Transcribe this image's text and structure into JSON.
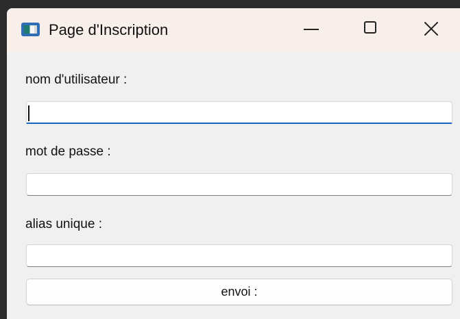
{
  "window": {
    "title": "Page d'Inscription",
    "app_icon": "app-window-icon",
    "controls": [
      {
        "name": "minimize",
        "icon": "minimize-icon"
      },
      {
        "name": "maximize",
        "icon": "maximize-icon"
      },
      {
        "name": "close",
        "icon": "close-icon"
      }
    ]
  },
  "form": {
    "username": {
      "label": "nom d'utilisateur :",
      "value": "",
      "placeholder": ""
    },
    "password": {
      "label": "mot de passe :",
      "value": "",
      "placeholder": ""
    },
    "alias": {
      "label": "alias unique :",
      "value": "",
      "placeholder": ""
    },
    "submit_label": "envoi :"
  },
  "colors": {
    "titlebar": "#f8efea",
    "window_bg": "#f0f0f0",
    "focus_accent": "#1565c0",
    "input_bg": "#ffffff"
  }
}
